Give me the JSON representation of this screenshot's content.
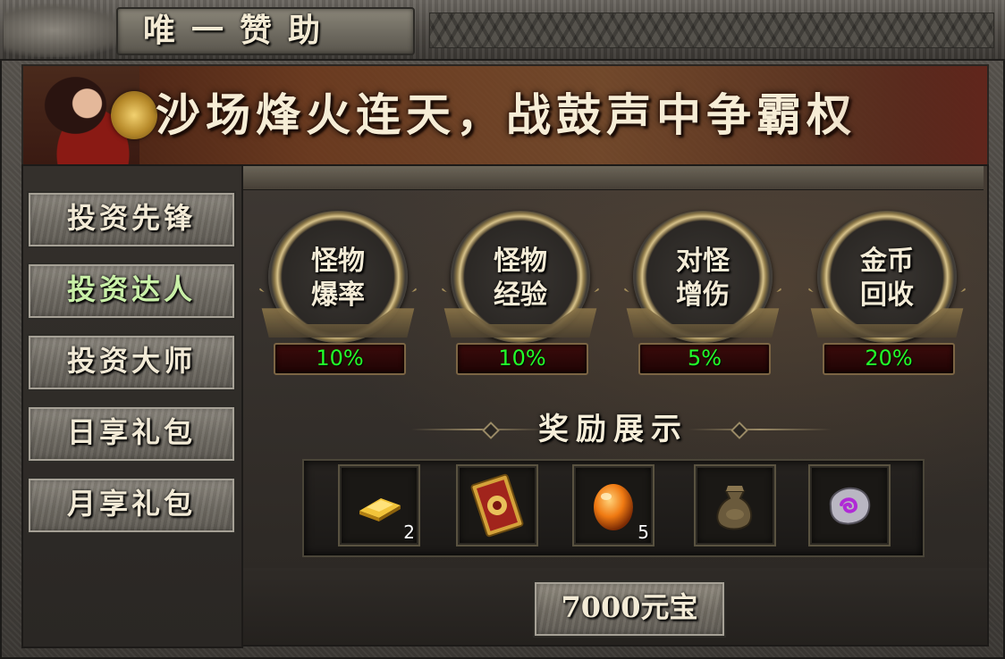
{
  "window": {
    "title": "唯一赞助"
  },
  "banner": {
    "slogan": "沙场烽火连天，战鼓声中争霸权"
  },
  "sidebar": {
    "items": [
      {
        "label": "投资先锋",
        "active": false
      },
      {
        "label": "投资达人",
        "active": true
      },
      {
        "label": "投资大师",
        "active": false
      },
      {
        "label": "日享礼包",
        "active": false
      },
      {
        "label": "月享礼包",
        "active": false
      }
    ]
  },
  "bonuses": [
    {
      "label": "怪物\n爆率",
      "value": "10%"
    },
    {
      "label": "怪物\n经验",
      "value": "10%"
    },
    {
      "label": "对怪\n增伤",
      "value": "5%"
    },
    {
      "label": "金币\n回收",
      "value": "20%"
    }
  ],
  "rewards": {
    "title": "奖励展示",
    "items": [
      {
        "icon": "gold-bar-icon",
        "count": "2"
      },
      {
        "icon": "golden-card-icon",
        "count": ""
      },
      {
        "icon": "orange-gem-icon",
        "count": "5"
      },
      {
        "icon": "coin-pouch-icon",
        "count": ""
      },
      {
        "icon": "purple-stone-icon",
        "count": ""
      }
    ]
  },
  "purchase": {
    "label": "7000元宝"
  },
  "colors": {
    "value_green": "#22ff2a",
    "active_menu": "#c9f0a8"
  }
}
